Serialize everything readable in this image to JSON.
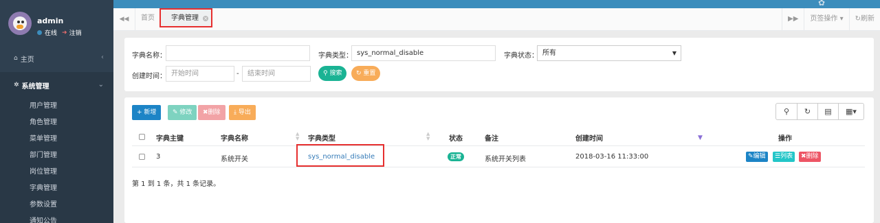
{
  "user": {
    "name": "admin",
    "status": "在线",
    "logout": "注销"
  },
  "sidebar": {
    "home": "主页",
    "system": "系统管理",
    "items": [
      "用户管理",
      "角色管理",
      "菜单管理",
      "部门管理",
      "岗位管理",
      "字典管理",
      "参数设置",
      "通知公告"
    ]
  },
  "tabs": {
    "home": "首页",
    "active": "字典管理",
    "page_ops": "页签操作",
    "refresh": "刷新"
  },
  "search": {
    "dict_name_label": "字典名称：",
    "dict_name_value": "",
    "dict_type_label": "字典类型：",
    "dict_type_value": "sys_normal_disable",
    "dict_status_label": "字典状态：",
    "dict_status_value": "所有",
    "created_label": "创建时间：",
    "start_placeholder": "开始时间",
    "end_placeholder": "结束时间",
    "dash": "-",
    "search_button": "搜索",
    "reset_button": "重置"
  },
  "toolbar": {
    "add": "新增",
    "edit": "修改",
    "delete": "删除",
    "export": "导出"
  },
  "table": {
    "headers": {
      "id": "字典主键",
      "name": "字典名称",
      "type": "字典类型",
      "status": "状态",
      "remark": "备注",
      "created": "创建时间",
      "ops": "操作"
    },
    "rows": [
      {
        "id": "3",
        "name": "系统开关",
        "type": "sys_normal_disable",
        "status": "正常",
        "remark": "系统开关列表",
        "created": "2018-03-16 11:33:00",
        "edit": "编辑",
        "list": "列表",
        "delete": "删除"
      }
    ],
    "summary": "第 1 到 1 条，共 1 条记录。"
  },
  "colors": {
    "primary": "#1c84c6",
    "success": "#1ab394",
    "warning": "#f8ac59",
    "danger": "#ed5565",
    "info": "#23c6c8",
    "sidebar": "#2f4050",
    "highlight": "#e62e2e"
  }
}
